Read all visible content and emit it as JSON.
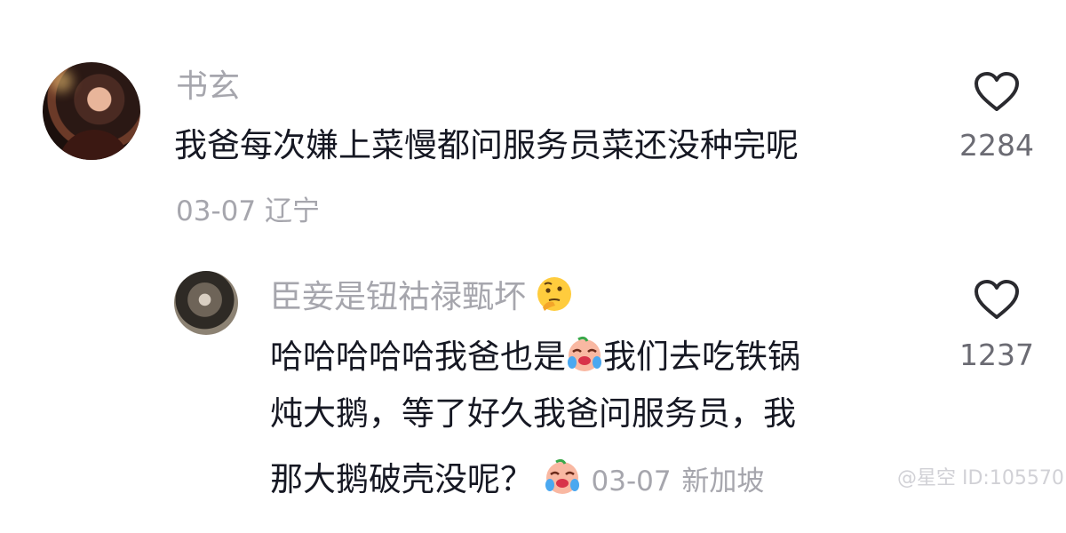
{
  "comments": [
    {
      "username": "书玄",
      "text": "我爸每次嫌上菜慢都问服务员菜还没种完呢",
      "date": "03-07",
      "location": "辽宁",
      "likes": "2284"
    }
  ],
  "reply": {
    "username": "臣妾是钮祜禄甄坏",
    "username_emoji": "thinking-face-icon",
    "lines": [
      "哈哈哈哈哈我爸也是",
      "我们去吃铁锅",
      "炖大鹅，等了好久我爸问服务员，我",
      "那大鹅破壳没呢？"
    ],
    "inline_emoji": "crying-laughing-icon",
    "date": "03-07",
    "location": "新加坡",
    "likes": "1237"
  },
  "watermark": "@星空 ID:105570"
}
